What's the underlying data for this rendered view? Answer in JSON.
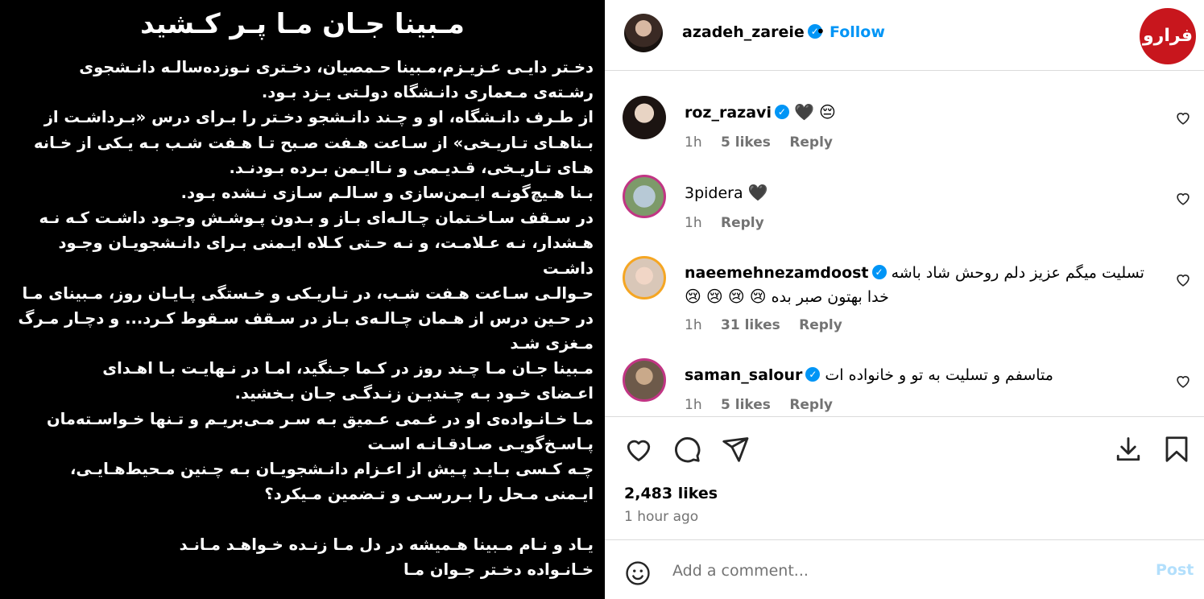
{
  "image": {
    "title": "مـبینا جـان مـا پـر کـشید",
    "lines": [
      "دخـتر دایـی عـزیـزم،مـبینا حـمصیان، دخـتری نـوزده‌سالـه دانـشجوی",
      "رشـته‌ی مـعماری دانـشگاه دولـتی یـزد بـود.",
      "از طـرف دانـشگاه، او و چـند دانـشجو دخـتر  را بـرای درس «بـرداشـت از",
      "بـناهـای تـاریـخی» از سـاعت هـفت صـبح تـا هـفت شـب بـه یـکی از خـانه",
      " هـای  تـاریـخی، قـدیـمی و نـاایـمن بـرده بـودنـد.",
      " بـنا هـیچ‌گونـه ایـمن‌سازی و  سـالـم سـازی نـشده بـود.",
      " در سـقف سـاخـتمان چـالـه‌ای بـاز و بـدون پـوشـش وجـود داشـت کـه نـه",
      "هـشدار، نـه عـلامـت، و نـه حـتی کـلاه ایـمنی بـرای دانـشجویـان وجـود",
      "داشـت",
      "حـوالـی سـاعت هـفت شـب، در تـاریـکی و خـستگی پـایـان روز، مـبینای مـا",
      "در حـین درس از هـمان چـالـه‌ی بـاز در سـقف سـقوط کـرد... و دچـار مـرگ",
      "مـغزی شـد",
      " مـبینا جـان مـا چـند روز در کـما جـنگید، امـا در نـهایـت بـا اهـدای",
      "اعـضای خـود بـه چـندیـن زنـدگـی جـان بـخشید.",
      "مـا خـانـواده‌ی او در غـمی عـمیق بـه سـر مـی‌بریـم و تـنها خـواسـته‌مان",
      "پـاسـخ‌گویـی صـادقـانـه اسـت",
      "چـه کـسی بـایـد پـیش از اعـزام دانـشجویـان بـه چـنین مـحیط‌هـایـی،",
      "ایـمنی مـحل را بـررسـی و تـضمین مـیکرد؟",
      "",
      "یـاد و نـام مـبینا هـمیشه در دل مـا زنـده خـواهـد مـانـد",
      "خـانـواده دخـتر جـوان مـا"
    ]
  },
  "header": {
    "username": "azadeh_zareie",
    "dot": "•",
    "follow_label": "Follow",
    "brand_logo_text": "فرارو"
  },
  "comments": [
    {
      "username": "roz_razavi",
      "verified": true,
      "text": "",
      "emojis": [
        "🖤",
        "😔"
      ],
      "time": "1h",
      "likes": "5 likes",
      "reply": "Reply"
    },
    {
      "username": "3pidera",
      "verified": false,
      "text": "",
      "emojis": [
        "🖤"
      ],
      "time": "1h",
      "likes": "",
      "reply": "Reply"
    },
    {
      "username": "naeemehnezamdoost",
      "verified": true,
      "text": "تسلیت میگم عزیز دلم روحش شاد باشه",
      "text2": "خدا بهتون صبر بده",
      "emojis2": [
        "😢",
        "😢",
        "😢",
        "😢"
      ],
      "time": "1h",
      "likes": "31 likes",
      "reply": "Reply"
    },
    {
      "username": "saman_salour",
      "verified": true,
      "text": "متاسفم و تسلیت به تو و خانواده ات",
      "time": "1h",
      "likes": "5 likes",
      "reply": "Reply"
    }
  ],
  "footer": {
    "likes_count": "2,483 likes",
    "time_ago": "1 hour ago",
    "comment_placeholder": "Add a comment...",
    "post_label": "Post"
  }
}
